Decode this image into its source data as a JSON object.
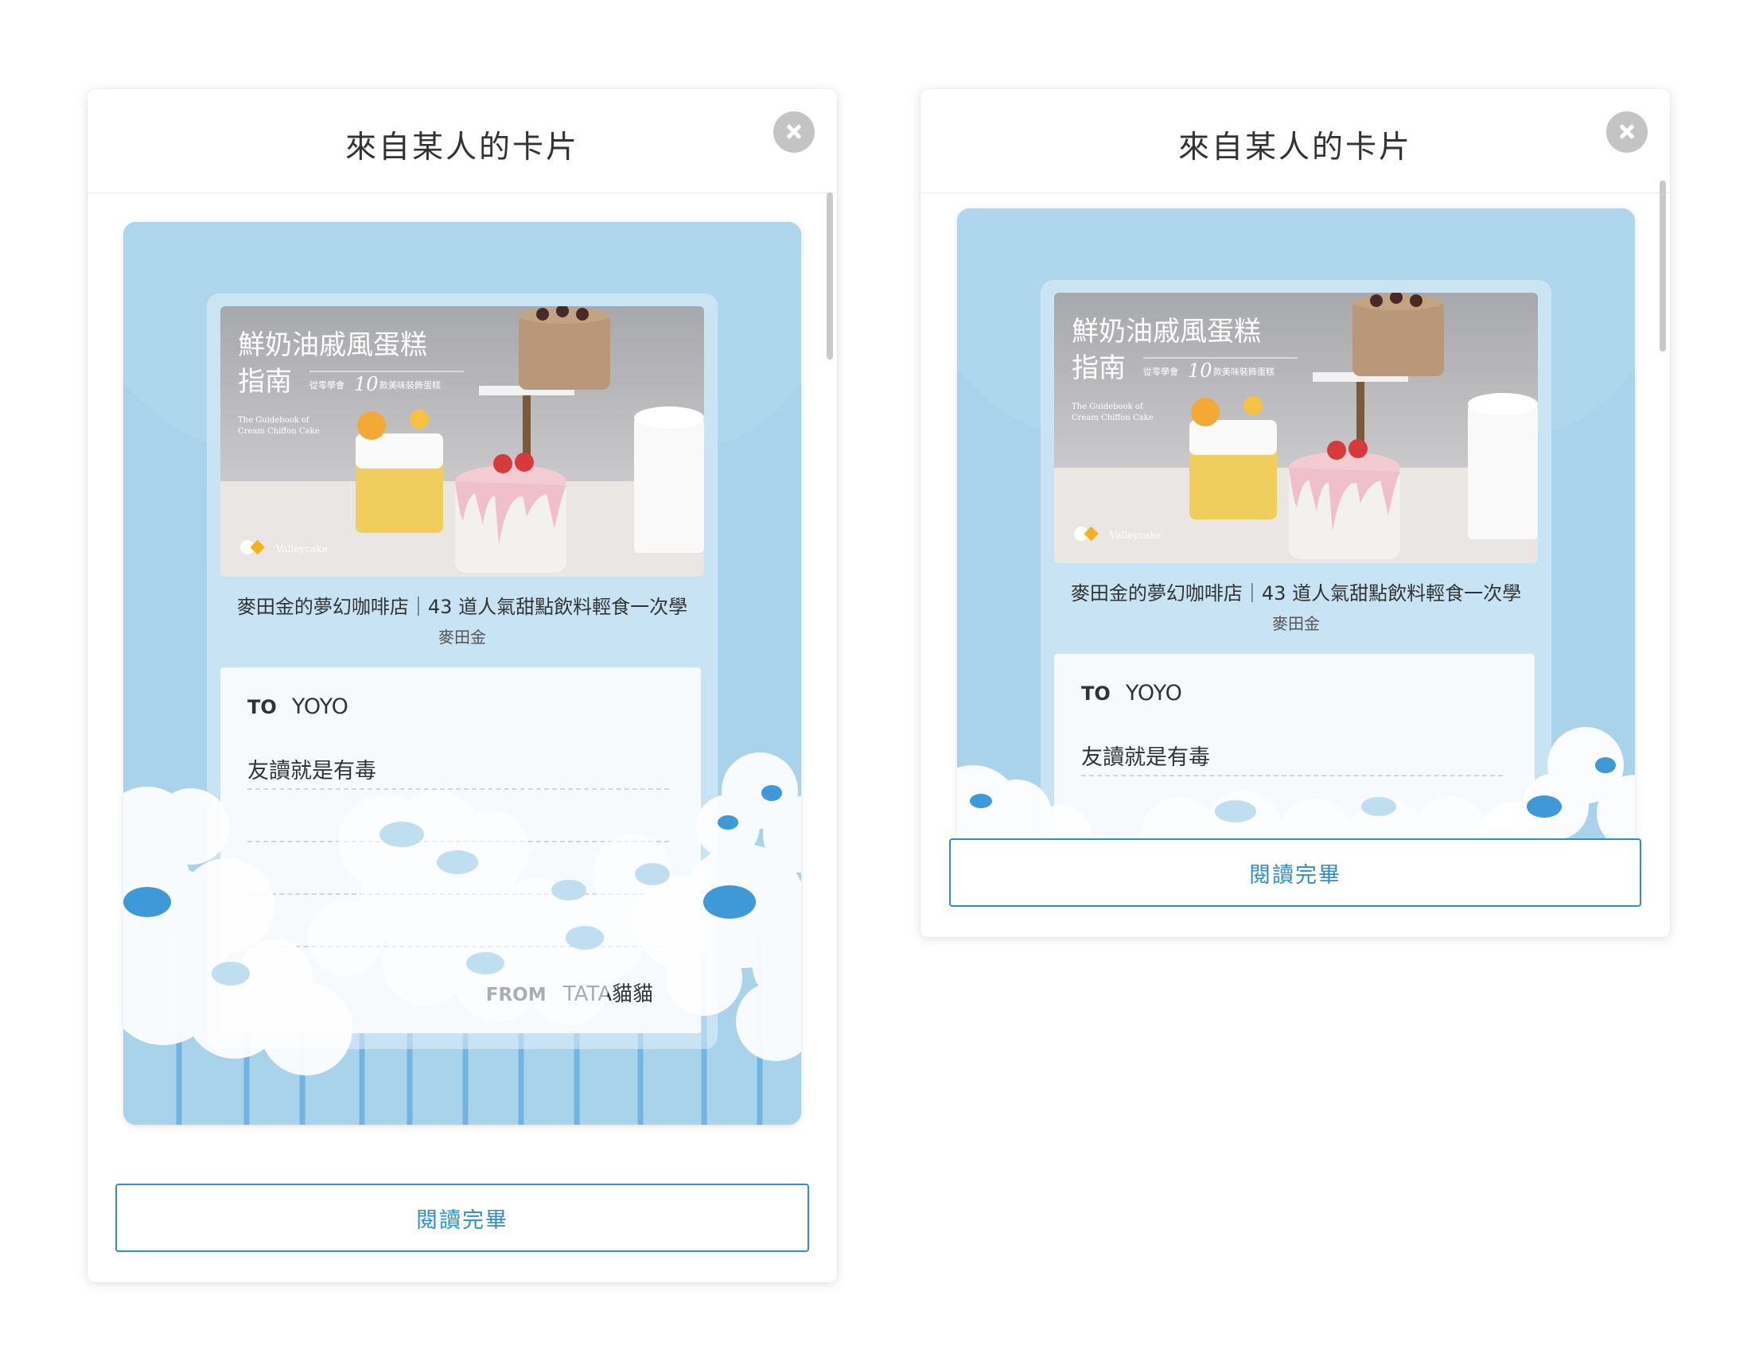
{
  "colors": {
    "accent": "#2e8fcf",
    "card_background": "#a9d3ea",
    "flower_white": "#ffffff",
    "flower_center_blue": "#3f99d8"
  },
  "modals": [
    {
      "title": "來自某人的卡片",
      "close_icon": "close-icon",
      "card": {
        "cover_title": "鮮奶油戚風蛋糕",
        "cover_title_line2": "指南",
        "cover_subtitle_pre": "從零學會",
        "cover_subtitle_num": "10",
        "cover_subtitle_post": "款美味裝飾蛋糕",
        "cover_en_line1": "The Guidebook of",
        "cover_en_line2": "Cream Chiffon Cake",
        "cover_brand": "Valleycake",
        "book_title": "麥田金的夢幻咖啡店｜43 道人氣甜點飲料輕食一次學",
        "book_author": "麥田金",
        "to_label": "TO",
        "to_name": "YOYO",
        "message": "友讀就是有毒",
        "from_label": "FROM",
        "from_name": "TATA貓貓"
      },
      "button_label": "閱讀完畢"
    },
    {
      "title": "來自某人的卡片",
      "close_icon": "close-icon",
      "card": {
        "cover_title": "鮮奶油戚風蛋糕",
        "cover_title_line2": "指南",
        "cover_subtitle_pre": "從零學會",
        "cover_subtitle_num": "10",
        "cover_subtitle_post": "款美味裝飾蛋糕",
        "cover_en_line1": "The Guidebook of",
        "cover_en_line2": "Cream Chiffon Cake",
        "cover_brand": "Valleycake",
        "book_title": "麥田金的夢幻咖啡店｜43 道人氣甜點飲料輕食一次學",
        "book_author": "麥田金",
        "to_label": "TO",
        "to_name": "YOYO",
        "message": "友讀就是有毒"
      },
      "button_label": "閱讀完畢"
    }
  ]
}
